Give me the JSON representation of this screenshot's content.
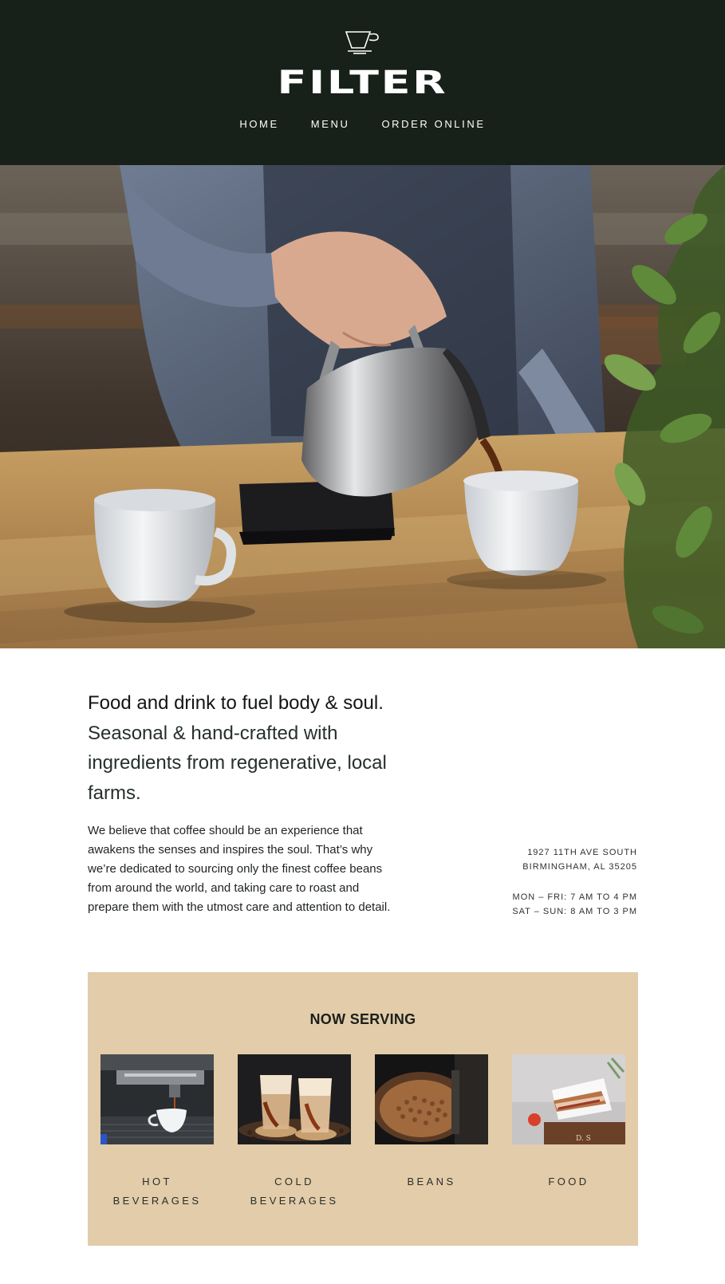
{
  "header": {
    "logo_icon": "pour-over-dripper-icon",
    "brand": "FILTER",
    "nav": [
      {
        "label": "HOME"
      },
      {
        "label": "MENU"
      },
      {
        "label": "ORDER ONLINE"
      }
    ],
    "background": "#172019"
  },
  "intro": {
    "headline_lead": "Food and drink to fuel body & soul.",
    "headline_rest": "Seasonal & hand-crafted with ingredients from regenerative, local farms.",
    "body": "We believe that coffee should be an experience that awakens the senses and inspires the soul. That’s why we’re dedicated to sourcing only the finest coffee beans from around the world, and taking care to roast and prepare them with the utmost care and attention to detail."
  },
  "info": {
    "address_line1": "1927 11TH AVE SOUTH",
    "address_line2": "BIRMINGHAM, AL 35205",
    "hours_weekday": "MON – FRI: 7 AM TO 4 PM",
    "hours_weekend": "SAT – SUN: 8 AM TO 3 PM"
  },
  "serving": {
    "title": "NOW SERVING",
    "background": "#e3cca9",
    "items": [
      {
        "label": "HOT BEVERAGES"
      },
      {
        "label": "COLD BEVERAGES"
      },
      {
        "label": "BEANS"
      },
      {
        "label": "FOOD"
      }
    ]
  }
}
